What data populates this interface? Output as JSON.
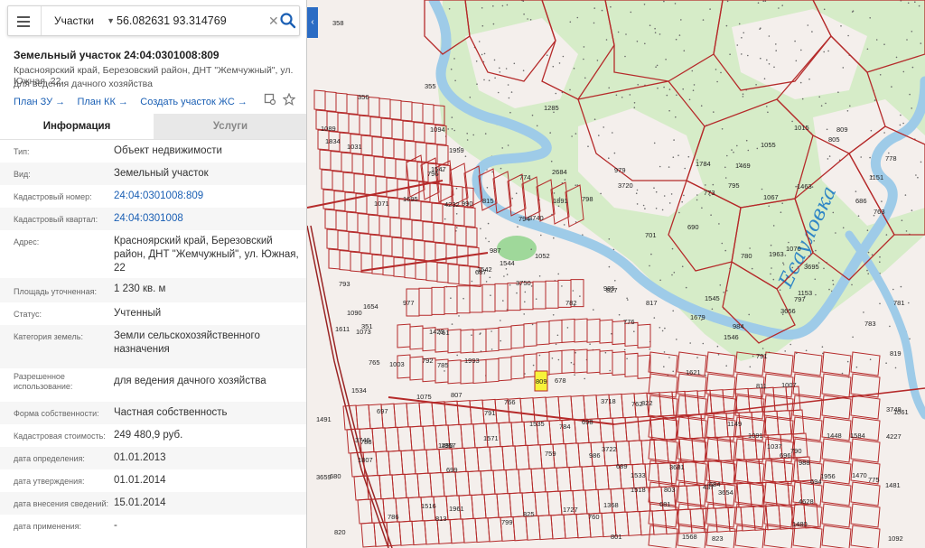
{
  "search": {
    "type_label": "Участки",
    "query": "56.082631 93.314769"
  },
  "parcel": {
    "title": "Земельный участок 24:04:0301008:809",
    "address": "Красноярский край, Березовский район, ДНТ \"Жемчужный\", ул. Южная, 22",
    "purpose": "для ведения дачного хозяйства",
    "links": [
      "План ЗУ →",
      "План КК →",
      "Создать участок ЖС →"
    ]
  },
  "tabs": [
    "Информация",
    "Услуги"
  ],
  "info_rows": [
    {
      "key": "Тип:",
      "value": "Объект недвижимости"
    },
    {
      "key": "Вид:",
      "value": "Земельный участок"
    },
    {
      "key": "Кадастровый номер:",
      "value": "24:04:0301008:809"
    },
    {
      "key": "Кадастровый квартал:",
      "value": "24:04:0301008"
    },
    {
      "key": "Адрес:",
      "value": "Красноярский край, Березовский район, ДНТ \"Жемчужный\", ул. Южная, 22"
    },
    {
      "key": "Площадь уточненная:",
      "value": "1 230 кв. м"
    },
    {
      "key": "Статус:",
      "value": "Учтенный"
    },
    {
      "key": "Категория земель:",
      "value": "Земли сельскохозяйственного назначения"
    },
    {
      "key": "Разрешенное использование:",
      "value": "для ведения дачного хозяйства"
    },
    {
      "key": "Форма собственности:",
      "value": "Частная собственность"
    },
    {
      "key": "Кадастровая стоимость:",
      "value": "249 480,9 руб."
    },
    {
      "key": "дата определения:",
      "value": "01.01.2013"
    },
    {
      "key": "дата утверждения:",
      "value": "01.01.2014"
    },
    {
      "key": "дата внесения сведений:",
      "value": "15.01.2014"
    },
    {
      "key": "дата применения:",
      "value": "-"
    }
  ],
  "map": {
    "river_name": "Есауловка",
    "selected_plot": "809",
    "colors": {
      "boundary": "#b52a2a",
      "forest": "#cfeac3",
      "river": "#9ecbe8",
      "selected": "#f7f33a",
      "accent": "#1a5fb4"
    },
    "plot_labels": [
      "358",
      "356",
      "355",
      "1285",
      "1491",
      "1480",
      "1470",
      "3681",
      "1463",
      "4227",
      "3656",
      "3654",
      "1469",
      "1481",
      "1727",
      "1784",
      "3659",
      "1423",
      "2684",
      "4628",
      "678",
      "701",
      "699",
      "1448",
      "1450",
      "759",
      "760",
      "761",
      "762",
      "763",
      "765",
      "773",
      "766",
      "790",
      "791",
      "795",
      "797",
      "798",
      "799",
      "801",
      "803",
      "805",
      "807",
      "809",
      "811",
      "813",
      "815",
      "817",
      "819",
      "820",
      "822",
      "823",
      "825",
      "827",
      "778",
      "780",
      "781",
      "782",
      "783",
      "784",
      "785",
      "786",
      "788",
      "791",
      "792",
      "793",
      "794",
      "796",
      "774",
      "776",
      "775",
      "1834",
      "1368",
      "1568",
      "1545",
      "1961",
      "1963",
      "3695",
      "1542",
      "1611",
      "1621",
      "1695",
      "1679",
      "1654",
      "4232",
      "1534",
      "1535",
      "1533",
      "1544",
      "1546",
      "1547",
      "1584",
      "1571",
      "1516",
      "1518",
      "979",
      "986",
      "988",
      "990",
      "1003",
      "1007",
      "1015",
      "3740",
      "1149",
      "1151",
      "1153",
      "3746",
      "3749",
      "3750",
      "985",
      "984",
      "987",
      "1891",
      "690",
      "689",
      "680",
      "687",
      "684",
      "681",
      "1993",
      "1807",
      "694",
      "696",
      "697",
      "698",
      "351",
      "1091",
      "1092",
      "1094",
      "1089",
      "1090",
      "977",
      "1956",
      "437",
      "1957",
      "1959",
      "686",
      "1037",
      "1031",
      "1052",
      "1073",
      "1061",
      "1071",
      "3718",
      "3720",
      "3722",
      "1075",
      "1067",
      "1070",
      "1055"
    ]
  }
}
